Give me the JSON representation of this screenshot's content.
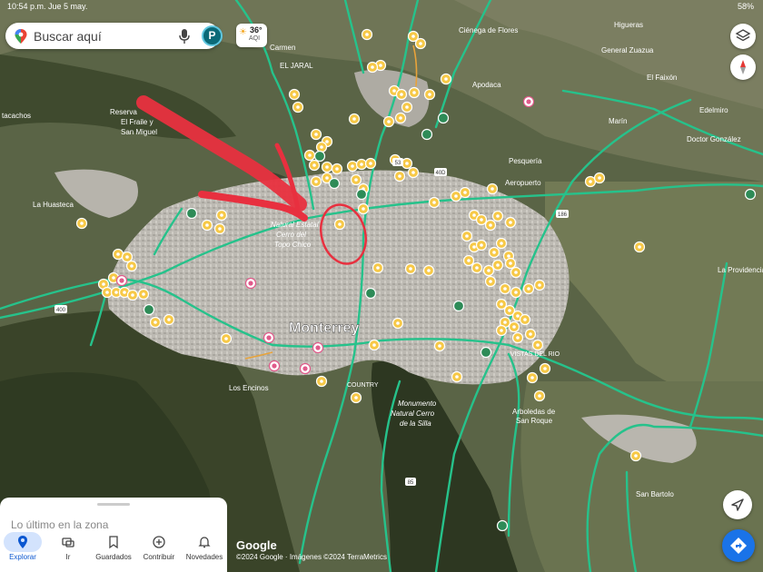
{
  "status_bar": {
    "time": "10:54 p.m. Jue 5 may.",
    "battery": "58%"
  },
  "search": {
    "placeholder": "Buscar aquí",
    "avatar_letter": "P"
  },
  "weather": {
    "temperature": "36°",
    "aqi_label": "AQI"
  },
  "map": {
    "city_label": "Monterrey",
    "labels": [
      {
        "name": "label-reserva",
        "text": "Reserva"
      },
      {
        "name": "label-el-fraile",
        "text": "El Fraile y"
      },
      {
        "name": "label-san-miguel",
        "text": "San Miguel"
      },
      {
        "name": "label-tacachos",
        "text": "tacachos"
      },
      {
        "name": "label-la-huasteca",
        "text": "La Huasteca"
      },
      {
        "name": "label-natural-estatal",
        "text": "Natural Estatal"
      },
      {
        "name": "label-cerro-del",
        "text": "Cerro del"
      },
      {
        "name": "label-topo-chico",
        "text": "Topo Chico"
      },
      {
        "name": "label-el-jaral",
        "text": "EL JARAL"
      },
      {
        "name": "label-carmen",
        "text": "Carmen"
      },
      {
        "name": "label-cienega",
        "text": "Ciénega de Flores"
      },
      {
        "name": "label-higueras",
        "text": "Higueras"
      },
      {
        "name": "label-general-zuazua",
        "text": "General Zuazua"
      },
      {
        "name": "label-el-fainon",
        "text": "El Faixón"
      },
      {
        "name": "label-edelmiro",
        "text": "Edelmiro"
      },
      {
        "name": "label-apodaca",
        "text": "Apodaca"
      },
      {
        "name": "label-pesqueria",
        "text": "Pesquería"
      },
      {
        "name": "label-aeropuerto",
        "text": "Aeropuerto"
      },
      {
        "name": "label-la-providencia",
        "text": "La Providencia"
      },
      {
        "name": "label-vistas-del-rio",
        "text": "VISTAS DEL RIO"
      },
      {
        "name": "label-los-encinos",
        "text": "Los Encinos"
      },
      {
        "name": "label-country",
        "text": "COUNTRY"
      },
      {
        "name": "label-monumento",
        "text": "Monumento"
      },
      {
        "name": "label-natural-cerro",
        "text": "Natural Cerro"
      },
      {
        "name": "label-de-la-silla",
        "text": "de la Silla"
      },
      {
        "name": "label-arboledas",
        "text": "Arboledas de"
      },
      {
        "name": "label-san-roque",
        "text": "San Roque"
      },
      {
        "name": "label-san-bartolo",
        "text": "San Bartolo"
      },
      {
        "name": "label-marin",
        "text": "Marín"
      },
      {
        "name": "label-doctor-gonzalez",
        "text": "Doctor González"
      }
    ],
    "highway_shields": [
      {
        "name": "shield-400",
        "text": "400"
      },
      {
        "name": "shield-85",
        "text": "85"
      },
      {
        "name": "shield-186",
        "text": "186"
      },
      {
        "name": "shield-40d",
        "text": "40D"
      },
      {
        "name": "shield-53",
        "text": "53"
      }
    ],
    "colors": {
      "road": "#26c28b",
      "poi_marker": "#f7c948",
      "annotation": "#e8303f",
      "park": "#2e8b57"
    }
  },
  "bottom_sheet": {
    "recent_title": "Lo último en la zona",
    "tabs": [
      {
        "name": "tab-explorar",
        "label": "Explorar",
        "icon": "location-pin-icon",
        "active": true
      },
      {
        "name": "tab-ir",
        "label": "Ir",
        "icon": "car-icon",
        "active": false
      },
      {
        "name": "tab-guardados",
        "label": "Guardados",
        "icon": "bookmark-icon",
        "active": false
      },
      {
        "name": "tab-contribuir",
        "label": "Contribuir",
        "icon": "add-circle-icon",
        "active": false
      },
      {
        "name": "tab-novedades",
        "label": "Novedades",
        "icon": "bell-icon",
        "active": false
      }
    ]
  },
  "footer": {
    "google_logo": "Google",
    "attribution": "©2024 Google · Imágenes ©2024 TerraMetrics"
  }
}
